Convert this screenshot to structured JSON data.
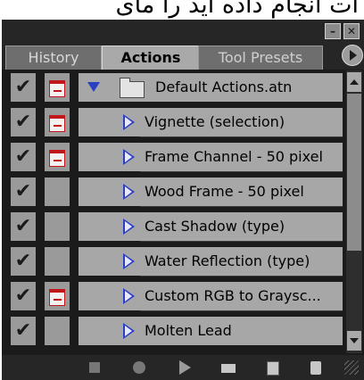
{
  "caption": {
    "text": "ات انجام داده اید را مای"
  },
  "window": {
    "minimize_glyph": "–",
    "close_glyph": "✕"
  },
  "tabs": [
    {
      "label": "History",
      "active": false
    },
    {
      "label": "Actions",
      "active": true
    },
    {
      "label": "Tool Presets",
      "active": false
    }
  ],
  "action_set": {
    "name": "Default Actions.atn",
    "checked": true,
    "dialog": true,
    "expanded": true
  },
  "actions": [
    {
      "name": "Vignette (selection)",
      "checked": true,
      "dialog": true
    },
    {
      "name": "Frame Channel - 50 pixel",
      "checked": true,
      "dialog": true
    },
    {
      "name": "Wood Frame - 50 pixel",
      "checked": true,
      "dialog": false
    },
    {
      "name": "Cast Shadow (type)",
      "checked": true,
      "dialog": false
    },
    {
      "name": "Water Reflection (type)",
      "checked": true,
      "dialog": false
    },
    {
      "name": "Custom RGB to Graysc...",
      "checked": true,
      "dialog": true
    },
    {
      "name": "Molten Lead",
      "checked": true,
      "dialog": false
    }
  ],
  "check_glyph": "✔",
  "colors": {
    "panel_bg": "#1b1b1b",
    "row_bg": "#a7a7a7",
    "accent_blue": "#2a3fc2",
    "dialog_red": "#c0181a"
  }
}
